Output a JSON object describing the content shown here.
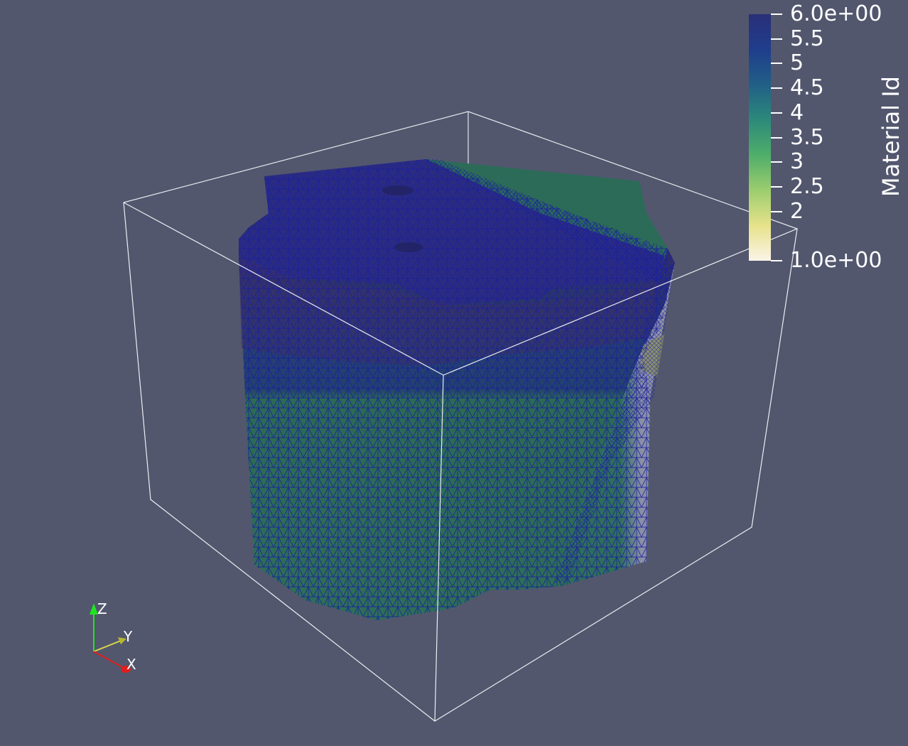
{
  "scalar_bar": {
    "title": "Material Id",
    "ticks": [
      {
        "label": "6.0e+00",
        "value": 6.0
      },
      {
        "label": "5.5",
        "value": 5.5
      },
      {
        "label": "5",
        "value": 5.0
      },
      {
        "label": "4.5",
        "value": 4.5
      },
      {
        "label": "4",
        "value": 4.0
      },
      {
        "label": "3.5",
        "value": 3.5
      },
      {
        "label": "3",
        "value": 3.0
      },
      {
        "label": "2.5",
        "value": 2.5
      },
      {
        "label": "2",
        "value": 2.0
      },
      {
        "label": "1.0e+00",
        "value": 1.0
      }
    ],
    "range": [
      1.0,
      6.0
    ],
    "colors": [
      "#fbf4e8",
      "#e6e28a",
      "#9ccd6e",
      "#4fae6a",
      "#2c8a7a",
      "#215f86",
      "#1f3d8c",
      "#2a2f78"
    ]
  },
  "axes": {
    "z_label": "Z",
    "y_label": "Y",
    "x_label": "X",
    "z_color": "#1ee61e",
    "y_color": "#d8d84a",
    "x_color": "#e11e1e"
  },
  "scene": {
    "background": "#52576e",
    "mesh_edge_color": "#1a1f9e",
    "outline_color": "#ffffff"
  }
}
